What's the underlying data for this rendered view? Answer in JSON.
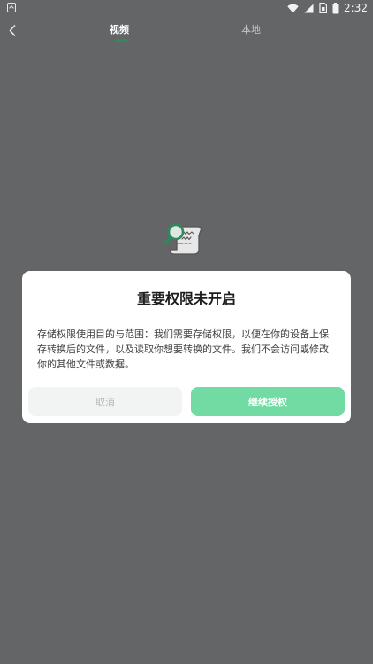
{
  "status_bar": {
    "time": "2:32",
    "icons": [
      "wifi-icon",
      "signal-icon",
      "sim-icon",
      "battery-icon"
    ]
  },
  "nav": {
    "back_icon": "chevron-left-icon",
    "tabs": [
      {
        "label": "视频",
        "active": true
      },
      {
        "label": "本地",
        "active": false
      }
    ],
    "accent_color": "#2f8a5c"
  },
  "empty_state": {
    "icon": "document-search-icon"
  },
  "dialog": {
    "title": "重要权限未开启",
    "message": "存储权限使用目的与范围：我们需要存储权限，以便在你的设备上保存转换后的文件，以及读取你想要转换的文件。我们不会访问或修改你的其他文件或数据。",
    "cancel_label": "取消",
    "confirm_label": "继续授权",
    "confirm_color": "#71dba3"
  }
}
